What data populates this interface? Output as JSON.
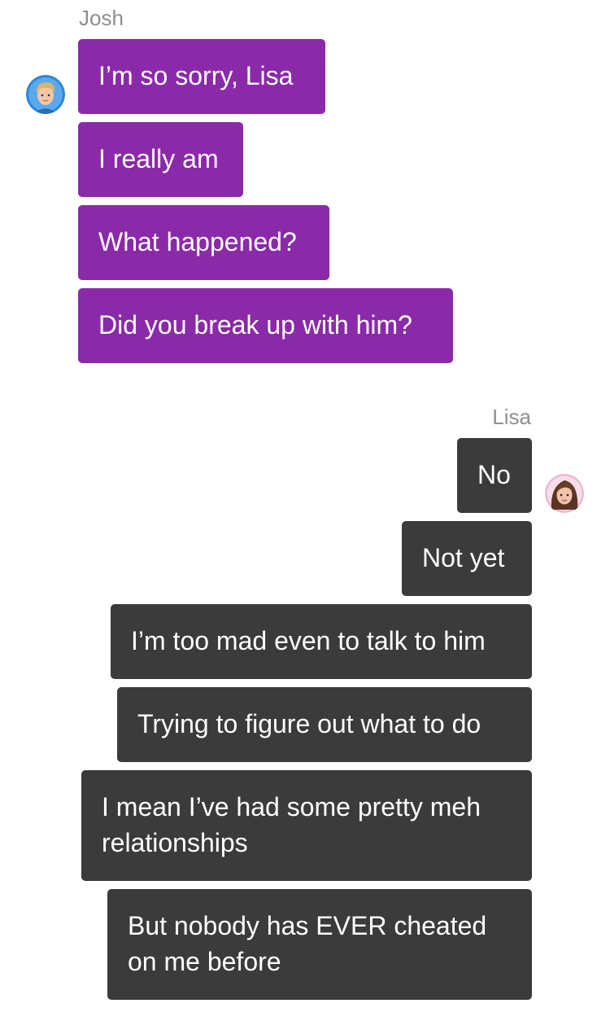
{
  "conversation": {
    "josh": {
      "name": "Josh",
      "bubble_color": "#8a2aa9",
      "avatar_icon": "boy-avatar-icon",
      "messages": [
        "I’m so sorry, Lisa",
        "I really am",
        "What happened?",
        "Did you break up with him?"
      ]
    },
    "lisa": {
      "name": "Lisa",
      "bubble_color": "#3b3b3b",
      "avatar_icon": "girl-avatar-icon",
      "messages": [
        "No",
        "Not yet",
        "I’m too mad even to talk to him",
        "Trying to figure out what to do",
        "I mean I’ve had some pretty meh relationships",
        "But nobody has EVER cheated on me before"
      ]
    }
  }
}
